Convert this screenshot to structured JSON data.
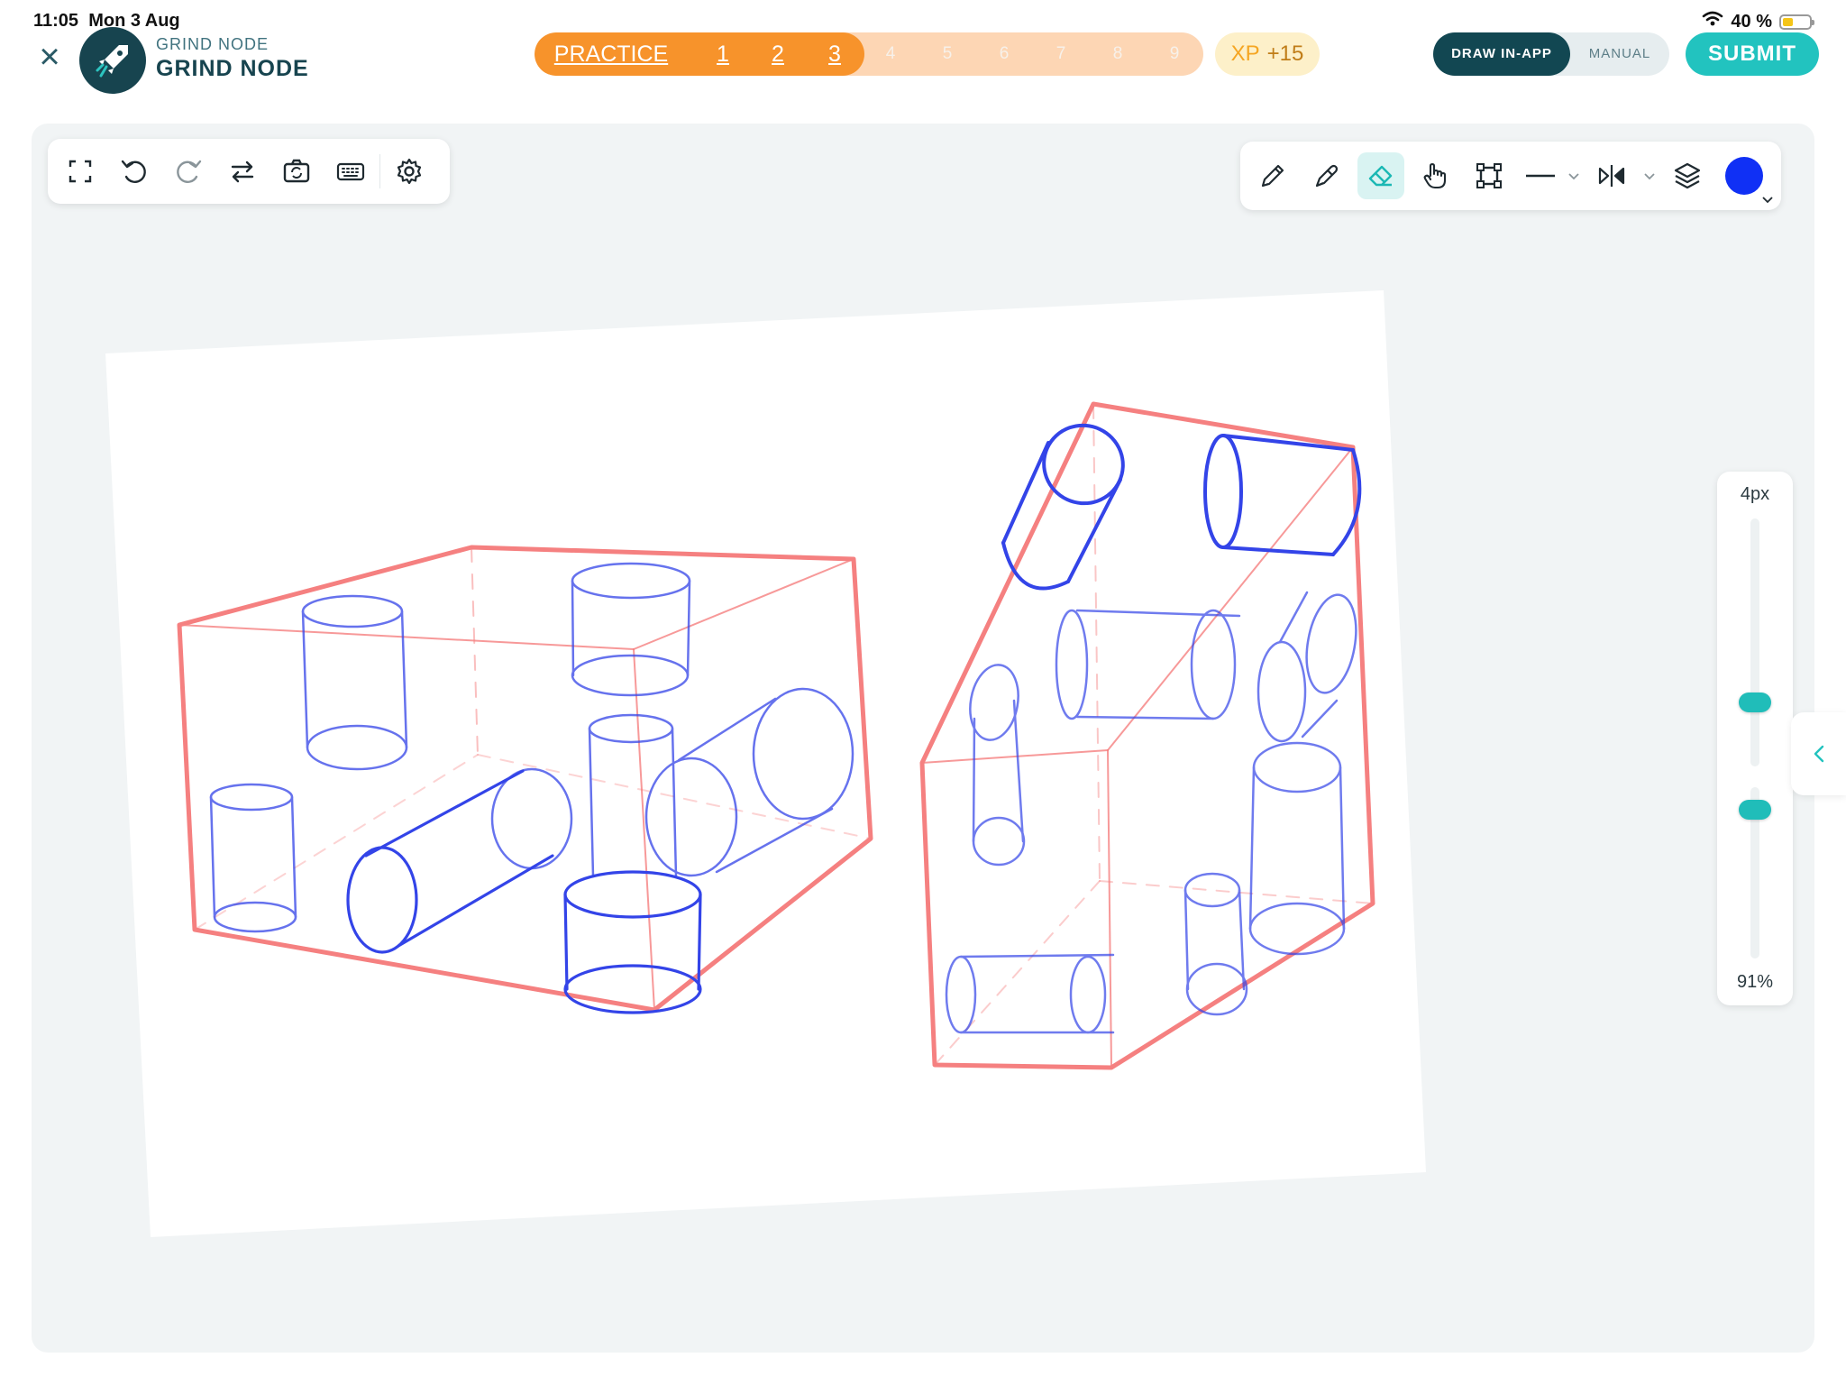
{
  "status_bar": {
    "time": "11:05",
    "date": "Mon 3 Aug",
    "battery": "40 %",
    "battery_level": 0.4,
    "battery_color": "#f5c518"
  },
  "header": {
    "close_icon": "close-icon",
    "brand_small": "GRIND NODE",
    "brand_big": "GRIND NODE",
    "progress": {
      "label": "PRACTICE",
      "steps": [
        "1",
        "2",
        "3",
        "4",
        "5",
        "6",
        "7",
        "8",
        "9"
      ],
      "completed": 3
    },
    "xp": {
      "label": "XP",
      "value": "+15"
    },
    "mode": {
      "active": "DRAW IN-APP",
      "inactive": "MANUAL"
    },
    "submit": "SUBMIT"
  },
  "toolbar_left": {
    "tools": [
      "fullscreen-icon",
      "undo-icon",
      "redo-icon",
      "swap-icon",
      "camera-rotate-icon",
      "keyboard-icon",
      "settings-icon"
    ]
  },
  "toolbar_right": {
    "tools": [
      "pencil-icon",
      "pen-icon",
      "eraser-icon",
      "hand-icon",
      "transform-icon",
      "line-icon",
      "mirror-icon",
      "layers-icon"
    ],
    "active_tool": "eraser-icon",
    "brush_color": "#1030f5"
  },
  "side_panel": {
    "size": "4px",
    "opacity": "91%"
  },
  "colors": {
    "accent": "#22c3bf",
    "brand_dark": "#124752",
    "progress_orange": "#f7932b",
    "box_red": "#f58080",
    "stroke_blue": "#2233dd"
  }
}
